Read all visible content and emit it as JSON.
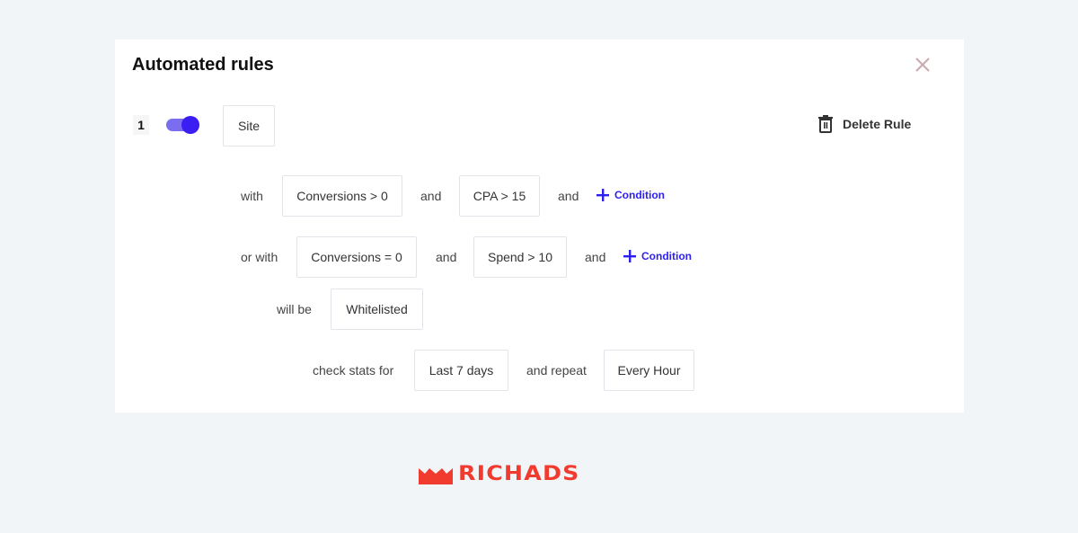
{
  "dialog": {
    "title": "Automated rules",
    "close_icon": "close-icon"
  },
  "rule": {
    "number": "1",
    "enabled": true,
    "target": "Site",
    "delete_label": "Delete Rule",
    "delete_icon": "trash-icon",
    "condition_group_1": {
      "prefix": "with",
      "condition_1": "Conversions > 0",
      "joiner_1": "and",
      "condition_2": "CPA > 15",
      "joiner_2": "and",
      "add_label": "Condition"
    },
    "condition_group_2": {
      "prefix": "or with",
      "condition_1": "Conversions = 0",
      "joiner_1": "and",
      "condition_2": "Spend > 10",
      "joiner_2": "and",
      "add_label": "Condition"
    },
    "action": {
      "prefix": "will be",
      "value": "Whitelisted"
    },
    "schedule": {
      "stats_prefix": "check stats for",
      "period": "Last 7 days",
      "repeat_prefix": "and repeat",
      "repeat": "Every Hour"
    }
  },
  "brand": {
    "name": "RICHADS",
    "color": "#f23b2f"
  },
  "colors": {
    "accent": "#3b1ff2",
    "toggle_track": "#7b6df0",
    "background": "#f2f5f8"
  }
}
